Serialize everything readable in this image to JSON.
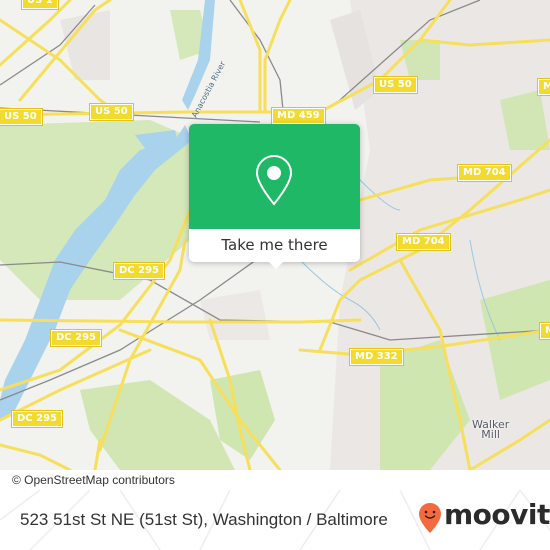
{
  "map": {
    "attribution": "© OpenStreetMap contributors",
    "route_shields": [
      {
        "id": "us1-top",
        "label": "US 1"
      },
      {
        "id": "us50-left",
        "label": "US 50"
      },
      {
        "id": "us50-mid",
        "label": "US 50"
      },
      {
        "id": "us50-right",
        "label": "US 50"
      },
      {
        "id": "md459",
        "label": "MD 459"
      },
      {
        "id": "md704-right",
        "label": "MD 704"
      },
      {
        "id": "md704-mid",
        "label": "MD 704"
      },
      {
        "id": "md-edge-top",
        "label": "MD"
      },
      {
        "id": "dc295-top",
        "label": "DC 295"
      },
      {
        "id": "dc295-mid",
        "label": "DC 295"
      },
      {
        "id": "dc295-bottom",
        "label": "DC 295"
      },
      {
        "id": "md332",
        "label": "MD 332"
      },
      {
        "id": "md-edge-bottom",
        "label": "M"
      }
    ],
    "places": [
      {
        "id": "walker-mill",
        "label": "Walker\nMill"
      }
    ],
    "water_labels": [
      {
        "id": "anacostia-river",
        "label": "Anacostia River"
      }
    ],
    "colors": {
      "background": "#f2f2ef",
      "park": "#cfe6b0",
      "water": "#a9d3ec",
      "road": "#f6df5a",
      "residential": "#e9e5e3",
      "rail": "#8a8a8a"
    }
  },
  "popup": {
    "icon": "map-pin-icon",
    "button_label": "Take me there",
    "color": "#1fb866"
  },
  "footer": {
    "address": "523 51st St NE (51st St), Washington / Baltimore",
    "brand": "moovit",
    "brand_icon": "moovit-smiley-pin-icon",
    "brand_color": "#f26a3d"
  }
}
